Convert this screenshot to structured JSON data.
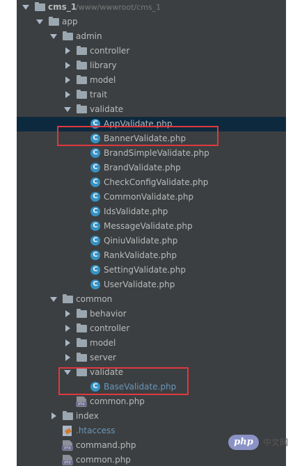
{
  "project": {
    "name": "cms_1",
    "path": "/www/wwwroot/cms_1"
  },
  "tree": [
    {
      "label": "app",
      "type": "folder",
      "expanded": true,
      "depth": 1
    },
    {
      "label": "admin",
      "type": "folder",
      "expanded": true,
      "depth": 2
    },
    {
      "label": "controller",
      "type": "folder",
      "expanded": false,
      "depth": 3
    },
    {
      "label": "library",
      "type": "folder",
      "expanded": false,
      "depth": 3
    },
    {
      "label": "model",
      "type": "folder",
      "expanded": false,
      "depth": 3
    },
    {
      "label": "trait",
      "type": "folder",
      "expanded": false,
      "depth": 3
    },
    {
      "label": "validate",
      "type": "folder",
      "expanded": true,
      "depth": 3
    },
    {
      "label": "AppValidate.php",
      "type": "class",
      "depth": 4,
      "selected": true
    },
    {
      "label": "BannerValidate.php",
      "type": "class",
      "depth": 4
    },
    {
      "label": "BrandSimpleValidate.php",
      "type": "class",
      "depth": 4
    },
    {
      "label": "BrandValidate.php",
      "type": "class",
      "depth": 4
    },
    {
      "label": "CheckConfigValidate.php",
      "type": "class",
      "depth": 4
    },
    {
      "label": "CommonValidate.php",
      "type": "class",
      "depth": 4
    },
    {
      "label": "IdsValidate.php",
      "type": "class",
      "depth": 4
    },
    {
      "label": "MessageValidate.php",
      "type": "class",
      "depth": 4
    },
    {
      "label": "QiniuValidate.php",
      "type": "class",
      "depth": 4
    },
    {
      "label": "RankValidate.php",
      "type": "class",
      "depth": 4
    },
    {
      "label": "SettingValidate.php",
      "type": "class",
      "depth": 4
    },
    {
      "label": "UserValidate.php",
      "type": "class",
      "depth": 4
    },
    {
      "label": "common",
      "type": "folder",
      "expanded": true,
      "depth": 2
    },
    {
      "label": "behavior",
      "type": "folder",
      "expanded": false,
      "depth": 3
    },
    {
      "label": "controller",
      "type": "folder",
      "expanded": false,
      "depth": 3
    },
    {
      "label": "model",
      "type": "folder",
      "expanded": false,
      "depth": 3
    },
    {
      "label": "server",
      "type": "folder",
      "expanded": false,
      "depth": 3
    },
    {
      "label": "validate",
      "type": "folder",
      "expanded": true,
      "depth": 3
    },
    {
      "label": "BaseValidate.php",
      "type": "class",
      "depth": 4,
      "highlightText": true
    },
    {
      "label": "common.php",
      "type": "php",
      "depth": 3
    },
    {
      "label": "index",
      "type": "folder",
      "expanded": false,
      "depth": 2
    },
    {
      "label": ".htaccess",
      "type": "htaccess",
      "depth": 2,
      "highlightText": true
    },
    {
      "label": "command.php",
      "type": "php",
      "depth": 2
    },
    {
      "label": "common.php",
      "type": "php",
      "depth": 2
    }
  ],
  "icons": {
    "class_letter": "C",
    "php_tag": "php"
  },
  "colors": {
    "panel_bg": "#3c3f41",
    "selection_bg": "#0d293e",
    "text": "#bbbbbb",
    "class_icon": "#3592c4",
    "highlight_box": "#e0383e"
  },
  "watermark": {
    "badge": "php",
    "text": "中文网"
  }
}
